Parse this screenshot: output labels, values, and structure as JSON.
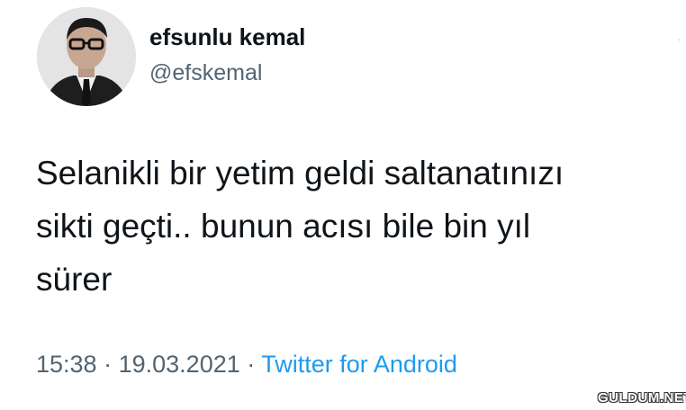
{
  "tweet": {
    "author": {
      "display_name": "efsunlu kemal",
      "handle": "@efskemal",
      "avatar_icon": "profile-photo"
    },
    "text": "Selanikli bir yetim geldi saltanatınızı\nsikti geçti.. bunun acısı bile bin yıl\nsürer",
    "time": "15:38",
    "separator": "·",
    "date": "19.03.2021",
    "source": "Twitter for Android"
  },
  "watermark": "GULDUM.NET",
  "colors": {
    "text_primary": "#0f1419",
    "text_secondary": "#536471",
    "accent": "#1d9bf0"
  }
}
